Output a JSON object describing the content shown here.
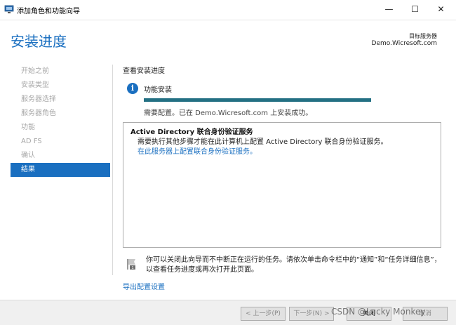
{
  "window": {
    "title": "添加角色和功能向导",
    "minimize": "—",
    "maximize": "☐",
    "close": "✕"
  },
  "header": {
    "title": "安装进度",
    "target_label": "目标服务器",
    "target_server": "Demo.Wicresoft.com"
  },
  "steps": [
    {
      "label": "开始之前",
      "active": false
    },
    {
      "label": "安装类型",
      "active": false
    },
    {
      "label": "服务器选择",
      "active": false
    },
    {
      "label": "服务器角色",
      "active": false
    },
    {
      "label": "功能",
      "active": false
    },
    {
      "label": "AD FS",
      "active": false
    },
    {
      "label": "确认",
      "active": false
    },
    {
      "label": "结果",
      "active": true
    }
  ],
  "main": {
    "section_label": "查看安装进度",
    "info_icon": "i",
    "feature_install": "功能安装",
    "progress": 1.0,
    "status": "需要配置。已在 Demo.Wicresoft.com 上安装成功。",
    "result": {
      "title": "Active Directory 联合身份验证服务",
      "description": "需要执行其他步骤才能在此计算机上配置 Active Directory 联合身份验证服务。",
      "link": "在此服务器上配置联合身份验证服务。"
    },
    "note": "你可以关闭此向导而不中断正在运行的任务。请依次单击命令栏中的“通知”和“任务详细信息”，以查看任务进度或再次打开此页面。",
    "export_link": "导出配置设置"
  },
  "footer": {
    "prev": "< 上一步(P)",
    "next": "下一步(N) >",
    "close": "关闭",
    "cancel": "取消",
    "watermark": "CSDN @Lucky Monkey"
  },
  "colors": {
    "accent": "#1a6fc0",
    "progress": "#237083"
  },
  "icons": {
    "app": "server-manager-icon",
    "info": "info-icon",
    "note": "flag-icon"
  }
}
